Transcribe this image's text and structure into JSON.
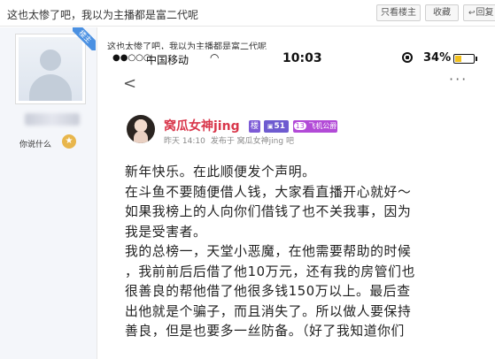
{
  "thread": {
    "title": "这也太惨了吧，我以为主播都是富二代呢",
    "buttons": {
      "only_author": "只看楼主",
      "collect": "收藏",
      "reply": "回复"
    }
  },
  "user": {
    "badge": "楼主",
    "signature": "你说什么",
    "level_icon": "trophy-icon"
  },
  "post": {
    "text": "这也太惨了吧，我以为主播都是富二代呢"
  },
  "phone": {
    "signal": "●●○○○",
    "carrier": "中国移动",
    "time": "10:03",
    "battery_percent": "34%",
    "battery_level": 0.34,
    "more": "···"
  },
  "tieba": {
    "author_name": "窝瓜女神jing",
    "badge_lz": "楼",
    "level_label": "51",
    "level_prefix": "▣",
    "fly_num": "13",
    "fly_label": "飞机公爵",
    "time": "昨天 14:10",
    "posted_in": "发布于 窝瓜女神jing 吧",
    "body": [
      "新年快乐。在此顺便发个声明。",
      "在斗鱼不要随便借人钱，大家看直播开心就好～",
      "如果我榜上的人向你们借钱了也不关我事，因为",
      "我是受害者。",
      "我的总榜一，天堂小恶魔，在他需要帮助的时候",
      "，我前前后后借了他10万元，还有我的房管们也",
      "很善良的帮他借了他很多钱150万以上。最后查",
      "出他就是个骗子，而且消失了。所以做人要保持",
      "善良，但是也要多一丝防备。（好了我知道你们"
    ]
  }
}
